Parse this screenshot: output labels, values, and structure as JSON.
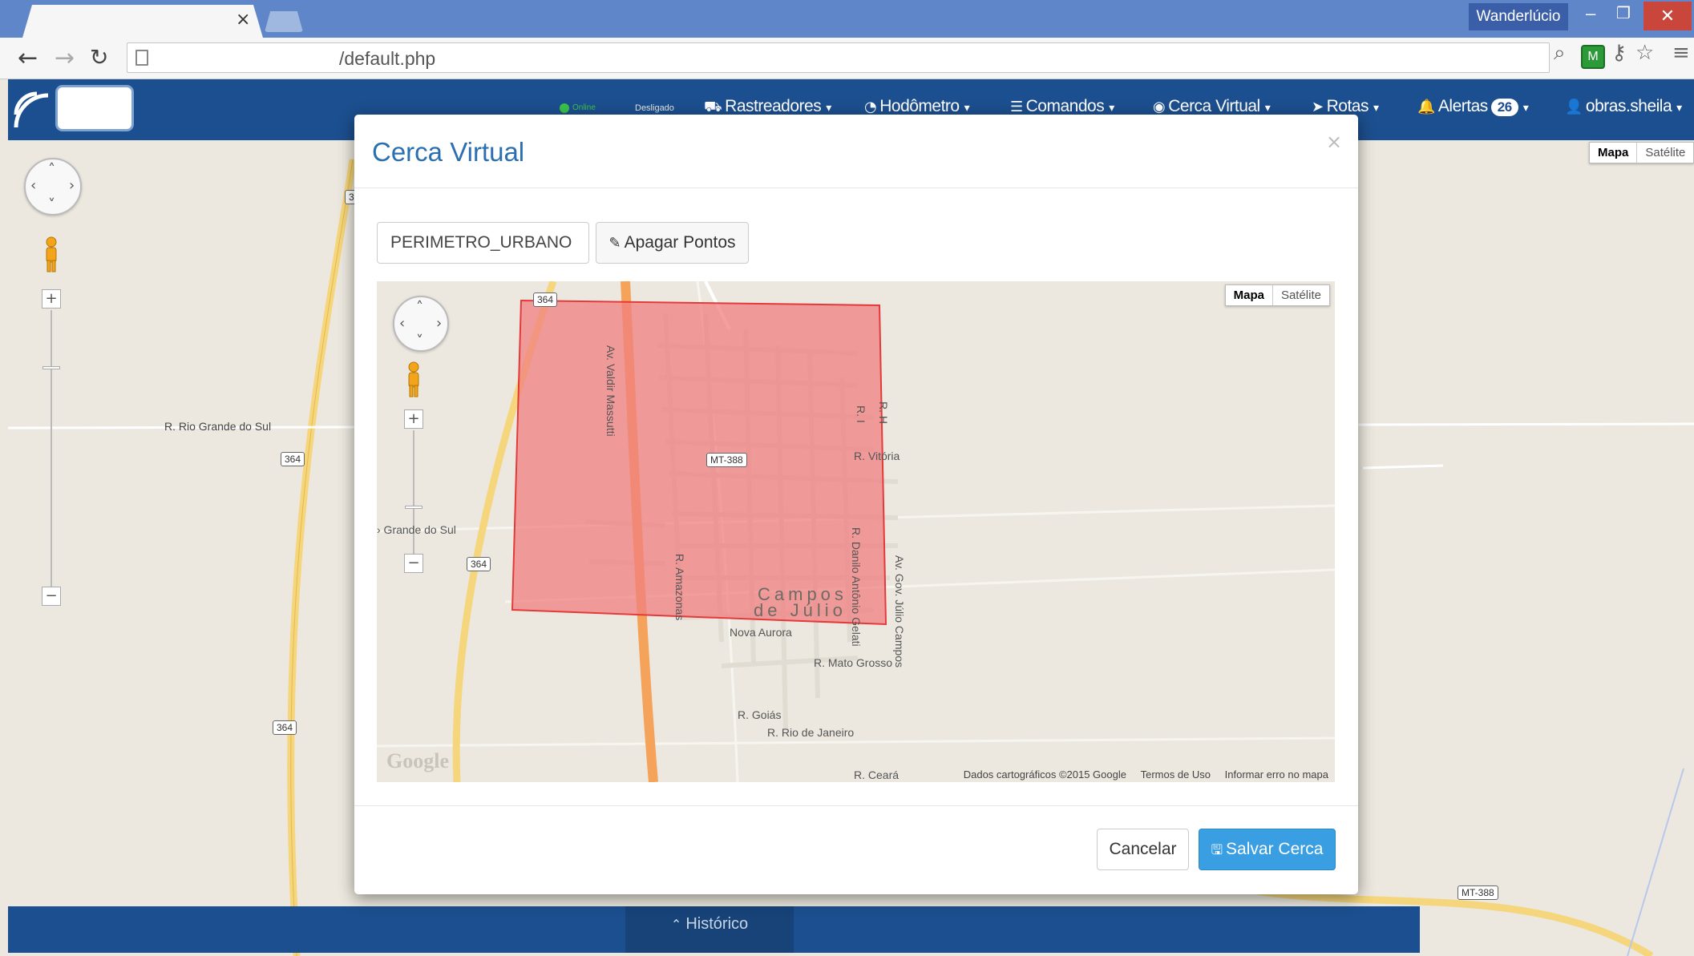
{
  "browser": {
    "tab_close": "×",
    "profile_name": "Wanderlúcio",
    "window_controls": {
      "minimize": "–",
      "maximize": "❐",
      "close": "✕"
    },
    "url": "/default.php",
    "icons": [
      "back-arrow-icon",
      "forward-arrow-icon",
      "reload-icon",
      "page-icon",
      "zoom-icon",
      "extension-icon",
      "key-icon",
      "star-icon",
      "menu-icon"
    ]
  },
  "app": {
    "status": {
      "online": "Online",
      "offline": "Desligado"
    },
    "nav": [
      {
        "label": "Rastreadores",
        "icon": "truck-icon"
      },
      {
        "label": "Hodômetro",
        "icon": "dashboard-icon"
      },
      {
        "label": "Comandos",
        "icon": "list-icon"
      },
      {
        "label": "Cerca Virtual",
        "icon": "fence-icon"
      },
      {
        "label": "Rotas",
        "icon": "route-icon"
      },
      {
        "label": "Alertas",
        "icon": "bell-icon",
        "count": "26"
      },
      {
        "label": "obras.sheila",
        "icon": "user-icon"
      }
    ],
    "map_type": {
      "map": "Mapa",
      "satellite": "Satélite"
    },
    "bg_labels": {
      "street": "R. Rio Grande do Sul",
      "shield_a": "364",
      "shield_b": "364",
      "shield_c": "MT-388",
      "shield_d": "3"
    },
    "bottom_tab": "Histórico"
  },
  "modal": {
    "title": "Cerca Virtual",
    "close": "×",
    "name_value": "PERIMETRO_URBANO",
    "clear_button": "Apagar Pontos",
    "map": {
      "map_type": {
        "map": "Mapa",
        "satellite": "Satélite"
      },
      "town": "Campos de Júlio",
      "town_line1": "Campos",
      "town_line2": "de Júlio",
      "streets": {
        "massutti": "Av. Valdir Massutti",
        "vitoria": "R. Vitória",
        "rh": "R. H",
        "ri": "R. I",
        "danilo": "R. Danilo Antônio Gelati",
        "julio": "Av. Gov. Júlio Campos",
        "amazonas": "R. Amazonas",
        "nova_aurora": "Nova Aurora",
        "mato_grosso": "R. Mato Grosso",
        "goias": "R. Goiás",
        "rio_janeiro": "R. Rio de Janeiro",
        "ceara": "R. Ceará",
        "grande_sul": "› Grande do Sul",
        "mt388": "MT-388",
        "s364a": "364",
        "s364b": "364"
      },
      "google": "Google",
      "attribution": "Dados cartográficos ©2015 Google",
      "terms": "Termos de Uso",
      "report": "Informar erro no mapa",
      "fence_color": "#f08080"
    },
    "cancel_button": "Cancelar",
    "save_button": "Salvar Cerca"
  }
}
